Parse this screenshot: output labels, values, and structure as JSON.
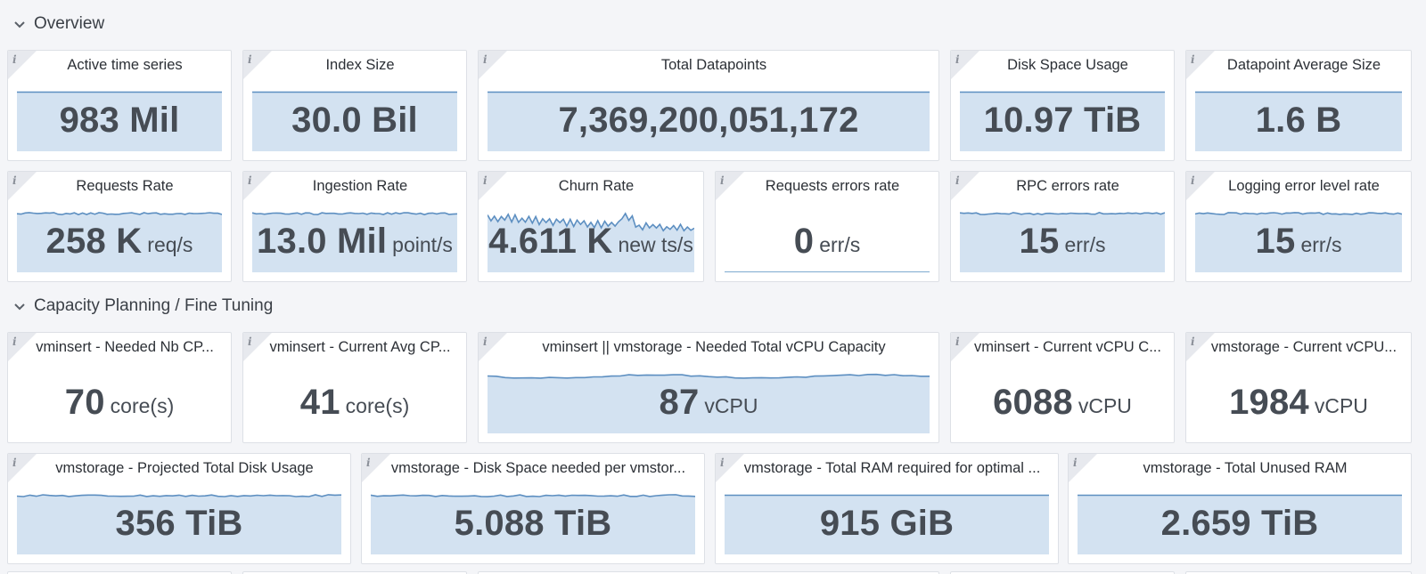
{
  "colors": {
    "spark_fill": "#d3e2f1",
    "spark_line": "#5d8fc1",
    "value": "#464c54"
  },
  "sections": {
    "overview": "Overview",
    "capacity": "Capacity Planning / Fine Tuning"
  },
  "panels": {
    "active_ts": {
      "title": "Active time series",
      "value": "983 Mil",
      "unit": ""
    },
    "index_size": {
      "title": "Index Size",
      "value": "30.0 Bil",
      "unit": ""
    },
    "total_dp": {
      "title": "Total Datapoints",
      "value": "7,369,200,051,172",
      "unit": ""
    },
    "disk_usage": {
      "title": "Disk Space Usage",
      "value": "10.97 TiB",
      "unit": ""
    },
    "dp_avg_size": {
      "title": "Datapoint Average Size",
      "value": "1.6 B",
      "unit": ""
    },
    "req_rate": {
      "title": "Requests Rate",
      "value": "258 K",
      "unit": "req/s"
    },
    "ingest_rate": {
      "title": "Ingestion Rate",
      "value": "13.0 Mil",
      "unit": "point/s"
    },
    "churn_rate": {
      "title": "Churn Rate",
      "value": "4.611 K",
      "unit": "new ts/s"
    },
    "req_err_rate": {
      "title": "Requests errors rate",
      "value": "0",
      "unit": "err/s"
    },
    "rpc_err_rate": {
      "title": "RPC errors rate",
      "value": "15",
      "unit": "err/s"
    },
    "log_err_rate": {
      "title": "Logging error level rate",
      "value": "15",
      "unit": "err/s"
    },
    "vminsert_needed_cpu": {
      "title": "vminsert - Needed Nb CP...",
      "value": "70",
      "unit": "core(s)"
    },
    "vminsert_current_cpu": {
      "title": "vminsert - Current Avg CP...",
      "value": "41",
      "unit": "core(s)"
    },
    "needed_total_vcpu": {
      "title": "vminsert || vmstorage - Needed Total vCPU Capacity",
      "value": "87",
      "unit": "vCPU"
    },
    "vminsert_current_vcpu": {
      "title": "vminsert - Current vCPU C...",
      "value": "6088",
      "unit": "vCPU"
    },
    "vmstorage_current_vcpu": {
      "title": "vmstorage - Current vCPU...",
      "value": "1984",
      "unit": "vCPU"
    },
    "proj_disk": {
      "title": "vmstorage - Projected Total Disk Usage",
      "value": "356 TiB",
      "unit": ""
    },
    "disk_per_node": {
      "title": "vmstorage - Disk Space needed per vmstor...",
      "value": "5.088 TiB",
      "unit": ""
    },
    "total_ram": {
      "title": "vmstorage - Total RAM required for optimal ...",
      "value": "915 GiB",
      "unit": ""
    },
    "unused_ram": {
      "title": "vmstorage - Total Unused RAM",
      "value": "2.659 TiB",
      "unit": ""
    }
  }
}
